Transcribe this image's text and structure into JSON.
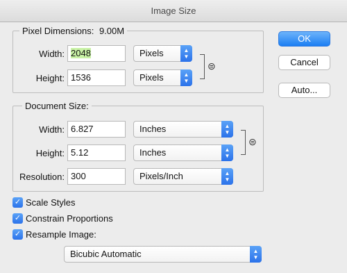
{
  "window": {
    "title": "Image Size"
  },
  "pixel_dimensions": {
    "legend": "Pixel Dimensions:",
    "size": "9.00M",
    "width_label": "Width:",
    "width_value": "2048",
    "width_unit": "Pixels",
    "height_label": "Height:",
    "height_value": "1536",
    "height_unit": "Pixels"
  },
  "document_size": {
    "legend": "Document Size:",
    "width_label": "Width:",
    "width_value": "6.827",
    "width_unit": "Inches",
    "height_label": "Height:",
    "height_value": "5.12",
    "height_unit": "Inches",
    "resolution_label": "Resolution:",
    "resolution_value": "300",
    "resolution_unit": "Pixels/Inch"
  },
  "options": {
    "scale_styles": {
      "label": "Scale Styles",
      "checked": true
    },
    "constrain_proportions": {
      "label": "Constrain Proportions",
      "checked": true
    },
    "resample_image": {
      "label": "Resample Image:",
      "checked": true
    },
    "resample_method": "Bicubic Automatic"
  },
  "buttons": {
    "ok": "OK",
    "cancel": "Cancel",
    "auto": "Auto..."
  },
  "icons": {
    "select_arrows": "updown-arrows-icon",
    "link": "chain-link-icon",
    "check": "checkmark-icon"
  },
  "colors": {
    "accent": "#2b72ea",
    "highlight": "#c9f2a6"
  }
}
